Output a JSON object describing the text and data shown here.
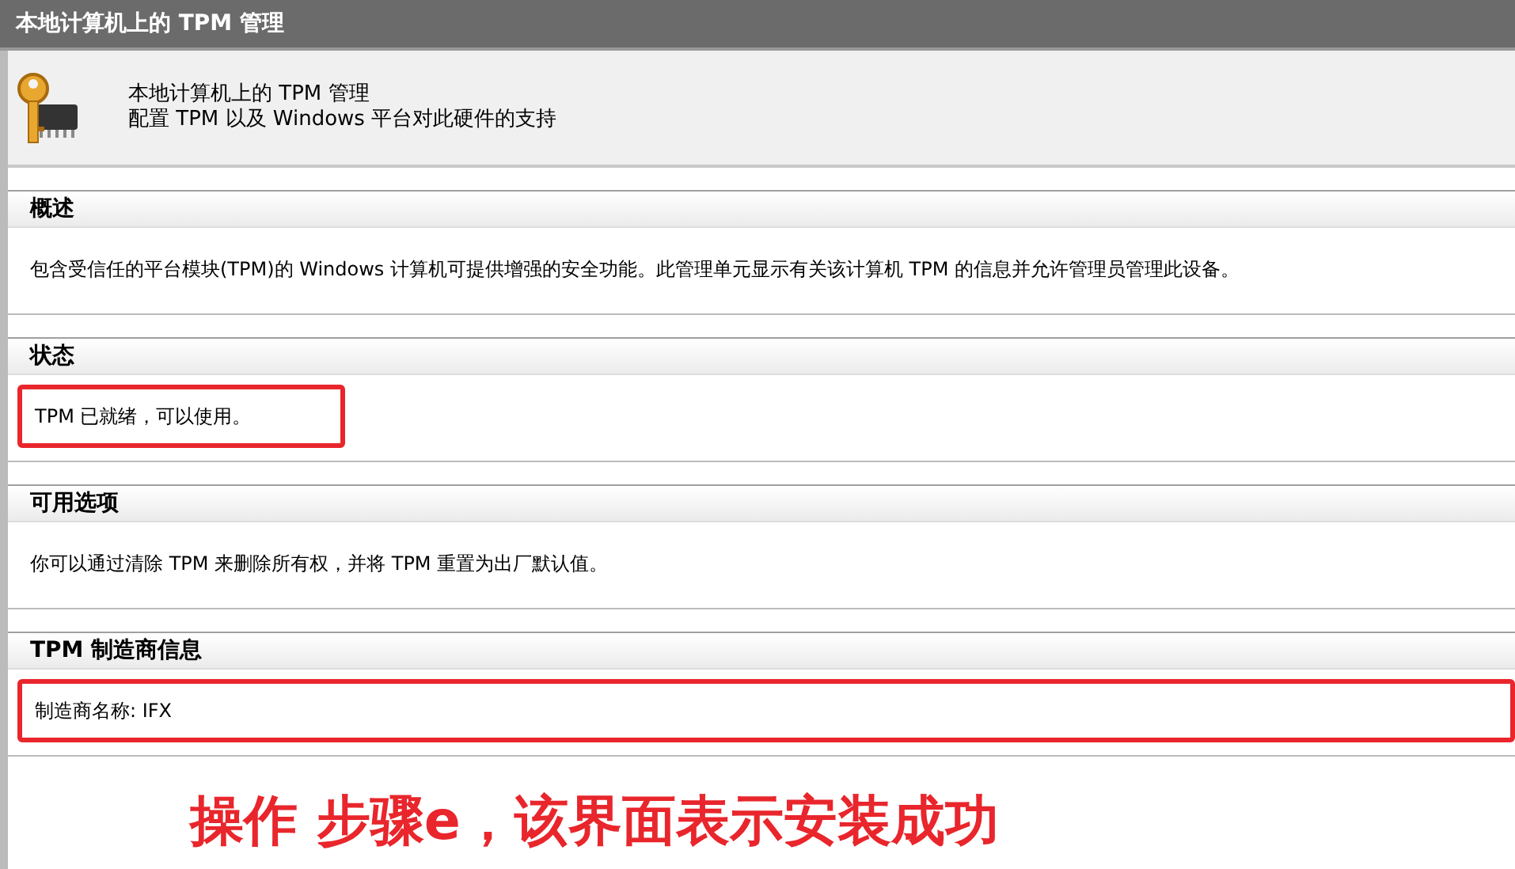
{
  "window": {
    "title": "本地计算机上的 TPM 管理"
  },
  "header": {
    "title": "本地计算机上的 TPM 管理",
    "subtitle": "配置 TPM 以及 Windows 平台对此硬件的支持"
  },
  "sections": [
    {
      "heading": "概述",
      "text": "包含受信任的平台模块(TPM)的 Windows 计算机可提供增强的安全功能。此管理单元显示有关该计算机 TPM 的信息并允许管理员管理此设备。",
      "highlighted": false
    },
    {
      "heading": "状态",
      "text": "TPM 已就绪，可以使用。",
      "highlighted": true
    },
    {
      "heading": "可用选项",
      "text": "你可以通过清除 TPM 来删除所有权，并将 TPM 重置为出厂默认值。",
      "highlighted": false
    },
    {
      "heading": "TPM 制造商信息",
      "text": "制造商名称: IFX",
      "highlighted": true
    }
  ],
  "annotation": "操作 步骤e，该界面表示安装成功"
}
